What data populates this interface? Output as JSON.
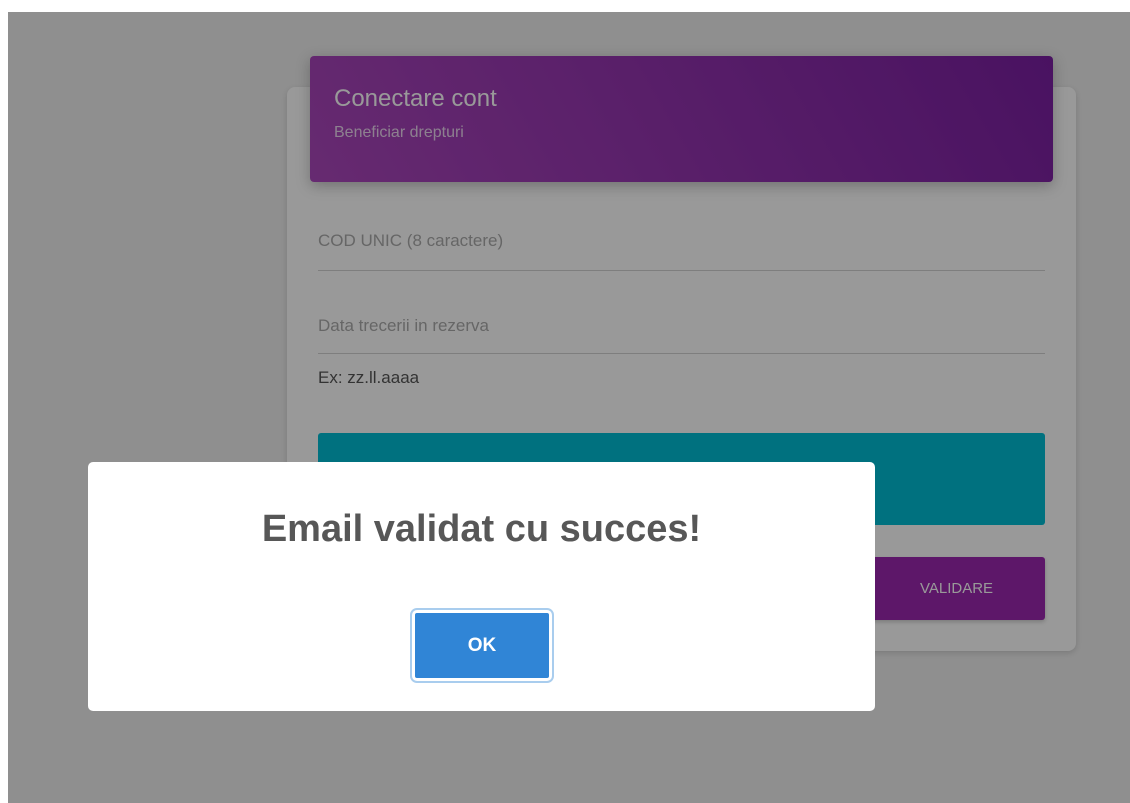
{
  "card": {
    "title": "Conectare cont",
    "subtitle": "Beneficiar drepturi"
  },
  "form": {
    "code_label": "COD UNIC (8 caractere)",
    "date_label": "Data trecerii in rezerva",
    "date_helper": "Ex: zz.ll.aaaa",
    "validate_label": "VALIDARE"
  },
  "modal": {
    "message": "Email validat cu succes!",
    "confirm_label": "OK"
  },
  "colors": {
    "header_purple": "#8e24aa",
    "validate_purple": "#9c27b0",
    "teal": "#00bcd4",
    "ok_blue": "#3085d6"
  }
}
